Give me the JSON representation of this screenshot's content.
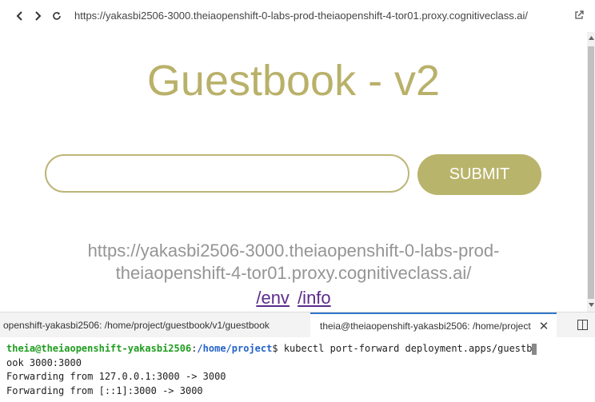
{
  "browser": {
    "url": "https://yakasbi2506-3000.theiaopenshift-0-labs-prod-theiaopenshift-4-tor01.proxy.cognitiveclass.ai/",
    "icons": [
      "back-icon",
      "forward-icon",
      "reload-icon",
      "open-external-icon"
    ]
  },
  "page": {
    "title": "Guestbook - v2",
    "input_value": "",
    "submit_label": "SUBMIT",
    "host_line1": "https://yakasbi2506-3000.theiaopenshift-0-labs-prod-",
    "host_line2": "theiaopenshift-4-tor01.proxy.cognitiveclass.ai/",
    "links": [
      {
        "label": "/env"
      },
      {
        "label": "/info"
      }
    ]
  },
  "terminal_panel": {
    "tabs": [
      {
        "label": "openshift-yakasbi2506: /home/project/guestbook/v1/guestbook"
      },
      {
        "label": "theia@theiaopenshift-yakasbi2506: /home/project",
        "active": true
      }
    ],
    "prompt_user": "theia@theiaopenshift-yakasbi2506",
    "prompt_sep": ":",
    "prompt_path": "/home/project",
    "prompt_symbol": "$",
    "command": "kubectl port-forward deployment.apps/guestb",
    "lines": [
      "ook 3000:3000",
      "Forwarding from 127.0.0.1:3000 -> 3000",
      "Forwarding from [::1]:3000 -> 3000"
    ]
  },
  "colors": {
    "accent": "#b9b46b",
    "link": "#5b2c8a",
    "active_tab": "#3078c9"
  }
}
